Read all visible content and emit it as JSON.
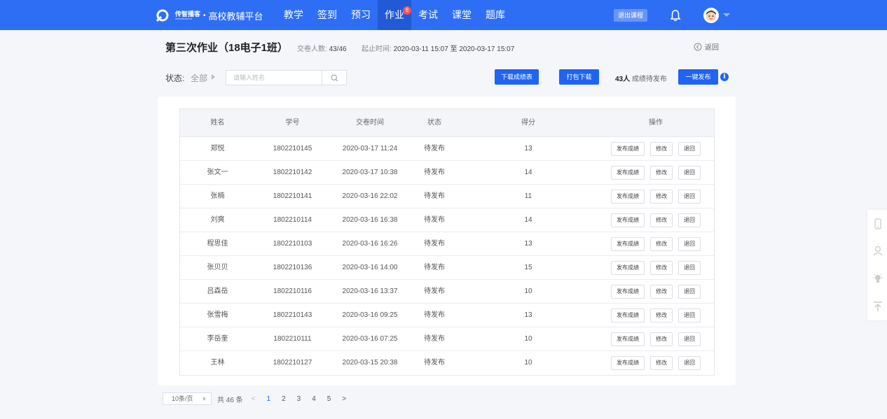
{
  "brand": {
    "name": "传智播客",
    "url": "www.itcast.cn",
    "platform": "高校教辅平台"
  },
  "nav": {
    "items": [
      {
        "label": "教学",
        "active": false
      },
      {
        "label": "签到",
        "active": false
      },
      {
        "label": "预习",
        "active": false
      },
      {
        "label": "作业",
        "active": true,
        "badge": "8"
      },
      {
        "label": "考试",
        "active": false
      },
      {
        "label": "课堂",
        "active": false
      },
      {
        "label": "题库",
        "active": false
      }
    ],
    "exit_label": "退出课程"
  },
  "header": {
    "title": "第三次作业（18电子1班）",
    "submit_label": "交卷人数:",
    "submit_value": "43/46",
    "time_label": "起止时间:",
    "time_start": "2020-03-11 15:07",
    "time_sep": "至",
    "time_end": "2020-03-17 15:07",
    "back_label": "返回"
  },
  "filter": {
    "status_label": "状态:",
    "status_value": "全部",
    "search_placeholder": "请输入姓名",
    "download_scores_label": "下载成绩表",
    "pack_download_label": "打包下载",
    "pending_count": "43人",
    "pending_text": "成绩待发布",
    "publish_all_label": "一键发布"
  },
  "table": {
    "columns": [
      "姓名",
      "学号",
      "交卷时间",
      "状态",
      "得分",
      "操作"
    ],
    "action_labels": [
      "发布成绩",
      "修改",
      "退回"
    ],
    "rows": [
      {
        "name": "郑悦",
        "id": "1802210145",
        "time": "2020-03-17 11:24",
        "status": "待发布",
        "score": "13"
      },
      {
        "name": "张文一",
        "id": "1802210142",
        "time": "2020-03-17 10:38",
        "status": "待发布",
        "score": "14"
      },
      {
        "name": "张楠",
        "id": "1802210141",
        "time": "2020-03-16 22:02",
        "status": "待发布",
        "score": "11"
      },
      {
        "name": "刘爽",
        "id": "1802210114",
        "time": "2020-03-16 16:38",
        "status": "待发布",
        "score": "14"
      },
      {
        "name": "程思佳",
        "id": "1802210103",
        "time": "2020-03-16 16:26",
        "status": "待发布",
        "score": "13"
      },
      {
        "name": "张贝贝",
        "id": "1802210136",
        "time": "2020-03-16 14:00",
        "status": "待发布",
        "score": "15"
      },
      {
        "name": "吕森岳",
        "id": "1802210116",
        "time": "2020-03-16 13:37",
        "status": "待发布",
        "score": "10"
      },
      {
        "name": "张雪梅",
        "id": "1802210143",
        "time": "2020-03-16 09:25",
        "status": "待发布",
        "score": "13"
      },
      {
        "name": "李岳奎",
        "id": "1802210111",
        "time": "2020-03-16 07:25",
        "status": "待发布",
        "score": "10"
      },
      {
        "name": "王林",
        "id": "1802210127",
        "time": "2020-03-15 20:38",
        "status": "待发布",
        "score": "10"
      }
    ]
  },
  "pagination": {
    "page_size": "10条/页",
    "total_text": "共 46 条",
    "prev": "<",
    "pages": [
      "1",
      "2",
      "3",
      "4",
      "5"
    ],
    "current": "1",
    "next": ">"
  },
  "colors": {
    "brand_blue": "#2e6ef5",
    "primary_button": "#1f64f2",
    "badge_red": "#f5504d"
  },
  "icons": [
    "logo-icon",
    "bell-icon",
    "avatar-icon",
    "back-icon",
    "search-icon",
    "info-icon",
    "phone-icon",
    "user-icon",
    "bulb-icon",
    "back-to-top-icon"
  ]
}
